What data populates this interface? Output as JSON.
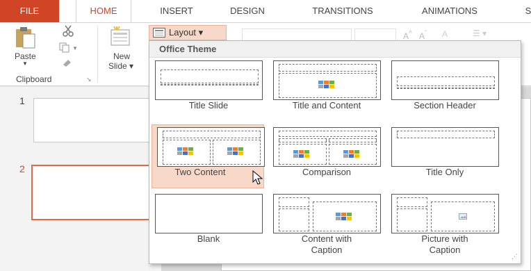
{
  "tabs": [
    "FILE",
    "HOME",
    "INSERT",
    "DESIGN",
    "TRANSITIONS",
    "ANIMATIONS",
    "S"
  ],
  "ribbon": {
    "paste_label": "Paste",
    "new_label": "New",
    "slide_label": "Slide",
    "clipboard_label": "Clipboard",
    "layout_label": "Layout"
  },
  "slides": {
    "numbers": [
      "1",
      "2"
    ]
  },
  "layout_menu": {
    "header": "Office Theme",
    "items": [
      "Title Slide",
      "Title and Content",
      "Section Header",
      "Two Content",
      "Comparison",
      "Title Only",
      "Blank",
      "Content with Caption",
      "Picture with Caption"
    ]
  },
  "colors": {
    "accent": "#d04525",
    "hover": "#f8d8c8",
    "hover_border": "#f0b297"
  }
}
